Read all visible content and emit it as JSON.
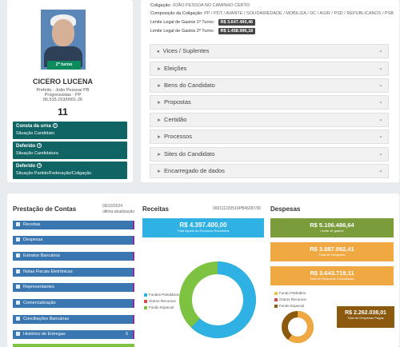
{
  "candidate": {
    "turno_badge": "2º turno",
    "name": "CICERO LUCENA",
    "role": "Prefeito - João Pessoa/ PB",
    "party": "Progressistas - PP",
    "cnpj": "56.515.153/0001-26",
    "number": "11",
    "status": [
      {
        "title": "Consta da urna",
        "sub": "Situação Candidato"
      },
      {
        "title": "Deferido",
        "sub": "Situação Candidatura"
      },
      {
        "title": "Deferido",
        "sub": "Situação Partido/Federação/Coligação"
      }
    ]
  },
  "coalition": {
    "label_name": "Coligação:",
    "name": "JOÃO PESSOA NO CAMINHO CERTO",
    "label_comp": "Composição da Coligação:",
    "composition": "PP / PDT / AVANTE / SOLIDARIEDADE / MOBILIZA / DC / AGIR / PSD / REPUBLICANOS / PSB",
    "limit1_label": "Limite Legal de Gastos 1º Turno:",
    "limit1_value": "R$ 3.647.490,46",
    "limit2_label": "Limite Legal de Gastos 2º Turno:",
    "limit2_value": "R$ 1.458.996,18"
  },
  "sections": [
    {
      "label": "Vices / Suplentes",
      "icon": "user-icon"
    },
    {
      "label": "Eleições",
      "icon": "arrow-icon"
    },
    {
      "label": "Bens do Candidato",
      "icon": "arrow-icon"
    },
    {
      "label": "Propostas",
      "icon": "arrow-icon"
    },
    {
      "label": "Certidão",
      "icon": "arrow-icon"
    },
    {
      "label": "Processos",
      "icon": "arrow-icon"
    },
    {
      "label": "Sites do Candidato",
      "icon": "arrow-icon"
    },
    {
      "label": "Encarregado de dados",
      "icon": "arrow-icon"
    }
  ],
  "prestacao": {
    "title": "Prestação de Contas",
    "date": "09/10/2024",
    "update": "última atualização",
    "items": [
      {
        "label": "Receitas",
        "count": ""
      },
      {
        "label": "Despesas",
        "count": ""
      },
      {
        "label": "Extratos Bancários",
        "count": ""
      },
      {
        "label": "Notas Fiscais Eletrônicas",
        "count": ""
      },
      {
        "label": "Representantes",
        "count": ""
      },
      {
        "label": "Comercialização",
        "count": ""
      },
      {
        "label": "Conciliações Bancárias",
        "count": ""
      },
      {
        "label": "Histórico de Entregas",
        "count": "5"
      }
    ]
  },
  "receitas": {
    "title": "Receitas",
    "id": "000111220516PB46287/30",
    "total_value": "R$ 4.397.400,00",
    "total_label": "Total líquido de Recursos Recebidos",
    "legend": [
      "Fundos Partidários",
      "Outros Recursos",
      "Fundo Especial"
    ],
    "colors": {
      "fundos": "#2fb1e3",
      "outros": "#d84b4b",
      "especial": "#7ec242"
    },
    "donut_pct": {
      "fundos": 62,
      "outros": 0,
      "especial": 38
    }
  },
  "despesas": {
    "title": "Despesas",
    "limit_value": "R$ 5.106.486,64",
    "limit_label": "Limite de gastos",
    "total_value": "R$ 3.887.062,41",
    "total_label": "Total de Despesas",
    "contr_value": "R$ 3.643.719,11",
    "contr_label": "Total de Despesas Contratadas",
    "paid_value": "R$ 2.262.038,01",
    "paid_label": "Total de Despesas Pagas",
    "legend": [
      "Fundo Partidário",
      "Outros Recursos",
      "Fundo Especial"
    ],
    "colors": {
      "limit": "#7b9c3a",
      "total": "#f0a842",
      "paid": "#8b5a0f"
    },
    "donut_pct": {
      "partidario": 60,
      "outros": 0,
      "especial": 40
    }
  }
}
